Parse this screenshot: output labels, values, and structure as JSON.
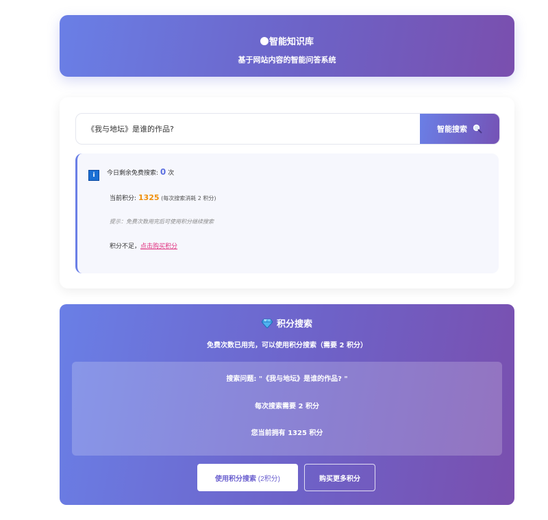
{
  "header": {
    "title": "智能知识库",
    "subtitle": "基于网站内容的智能问答系统"
  },
  "search": {
    "query": "《我与地坛》是谁的作品?",
    "button_label": "智能搜索",
    "button_icon": "magnifier-icon"
  },
  "info": {
    "icon": "info-icon",
    "remaining_label": "今日剩余免费搜索: ",
    "remaining_count": "0",
    "remaining_unit": " 次",
    "points_label": "当前积分: ",
    "points_value": "1325",
    "points_note": " (每次搜索消耗 2 积分)",
    "hint": "提示：免费次数用完后可使用积分继续搜索",
    "insufficient_label": "积分不足，",
    "buy_link": "点击购买积分"
  },
  "points_search": {
    "icon": "gem-icon",
    "title": "积分搜索",
    "description": "免费次数已用完，可以使用积分搜索（需要 2 积分）",
    "question_line": "搜索问题: \"《我与地坛》是谁的作品? \"",
    "cost_line": "每次搜索需要 2 积分",
    "owned_line": "您当前拥有 1325 积分",
    "use_button_main": "使用积分搜索",
    "use_button_paren": " (2积分)",
    "buy_button": "购买更多积分"
  },
  "colors": {
    "accent_start": "#6a7fe6",
    "accent_end": "#7a4fae",
    "points_orange": "#f0900c",
    "link_pink": "#e0307f"
  }
}
